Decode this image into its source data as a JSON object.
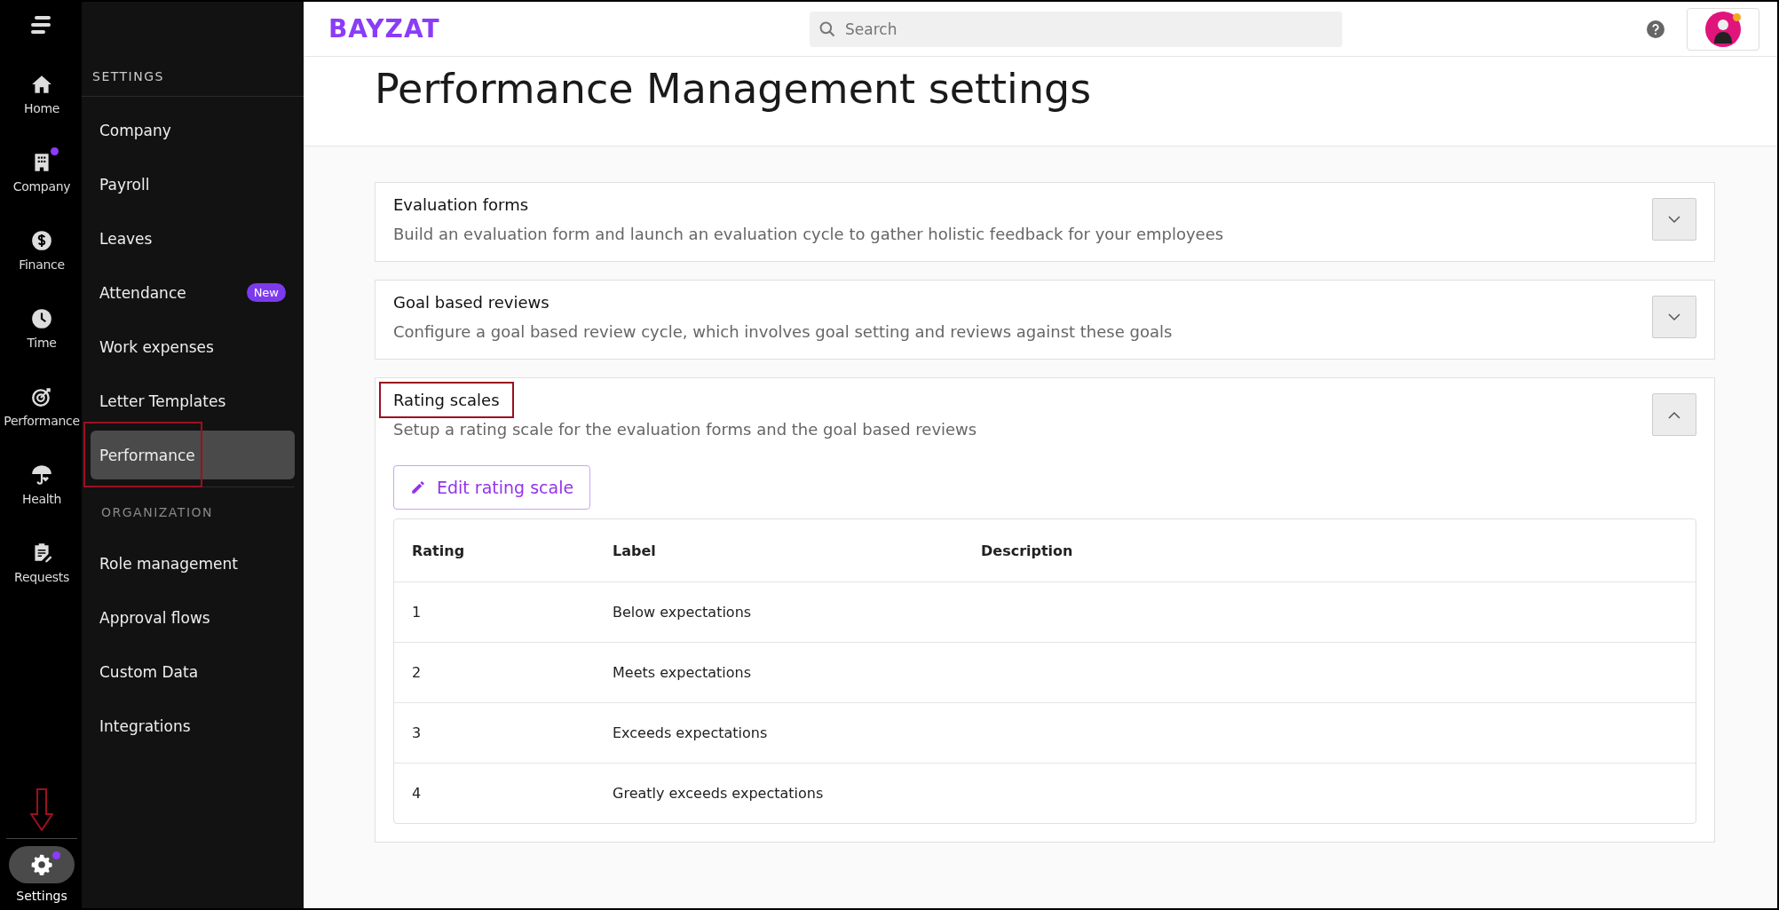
{
  "rail": {
    "items": [
      {
        "label": "Home",
        "dot": false,
        "selected": false
      },
      {
        "label": "Company",
        "dot": true,
        "selected": false
      },
      {
        "label": "Finance",
        "dot": false,
        "selected": false
      },
      {
        "label": "Time",
        "dot": false,
        "selected": false
      },
      {
        "label": "Performance",
        "dot": false,
        "selected": false
      },
      {
        "label": "Health",
        "dot": false,
        "selected": false
      },
      {
        "label": "Requests",
        "dot": false,
        "selected": false
      }
    ],
    "settings": {
      "label": "Settings",
      "dot": true,
      "selected": true,
      "arrow": true
    }
  },
  "sidebar": {
    "sections": [
      {
        "heading": "SETTINGS",
        "items": [
          {
            "label": "Company",
            "selected": false,
            "highlighted": false
          },
          {
            "label": "Payroll",
            "selected": false,
            "highlighted": false
          },
          {
            "label": "Leaves",
            "selected": false,
            "highlighted": false
          },
          {
            "label": "Attendance",
            "badge": "New",
            "selected": false,
            "highlighted": false
          },
          {
            "label": "Work expenses",
            "selected": false,
            "highlighted": false
          },
          {
            "label": "Letter Templates",
            "selected": false,
            "highlighted": false
          },
          {
            "label": "Performance",
            "selected": true,
            "highlighted": true
          }
        ]
      },
      {
        "heading": "ORGANIZATION",
        "items": [
          {
            "label": "Role management",
            "selected": false,
            "highlighted": false
          },
          {
            "label": "Approval flows",
            "selected": false,
            "highlighted": false
          },
          {
            "label": "Custom Data",
            "selected": false,
            "highlighted": false
          },
          {
            "label": "Integrations",
            "selected": false,
            "highlighted": false
          }
        ]
      }
    ]
  },
  "topbar": {
    "logo": "BAYZAT",
    "search": {
      "placeholder": "Search"
    },
    "notification_dot": true
  },
  "page": {
    "title": "Performance Management settings",
    "sections": [
      {
        "title": "Evaluation forms",
        "description": "Build an evaluation form and launch an evaluation cycle to gather holistic feedback for your employees",
        "expanded": false,
        "highlighted": false
      },
      {
        "title": "Goal based reviews",
        "description": "Configure a goal based review cycle, which involves goal setting and reviews against these goals",
        "expanded": false,
        "highlighted": false
      },
      {
        "title": "Rating scales",
        "description": "Setup a rating scale for the evaluation forms and the goal based reviews",
        "expanded": true,
        "highlighted": true,
        "button": "Edit rating scale",
        "table": {
          "columns": [
            "Rating",
            "Label",
            "Description"
          ],
          "rows": [
            [
              "1",
              "Below expectations",
              ""
            ],
            [
              "2",
              "Meets expectations",
              ""
            ],
            [
              "3",
              "Exceeds expectations",
              ""
            ],
            [
              "4",
              "Greatly exceeds expectations",
              ""
            ]
          ]
        }
      }
    ]
  }
}
